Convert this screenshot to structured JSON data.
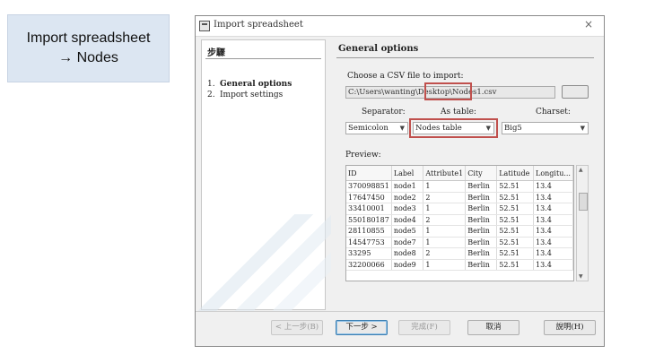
{
  "slide": {
    "caption_line1": "Import spreadsheet",
    "caption_line2": "→ Nodes"
  },
  "window": {
    "title": "Import spreadsheet",
    "close_glyph": "×"
  },
  "steps_panel": {
    "title": "步驟",
    "items": [
      {
        "num": "1.",
        "label": "General options"
      },
      {
        "num": "2.",
        "label": "Import settings"
      }
    ]
  },
  "general": {
    "section_title": "General options",
    "choose_label": "Choose a CSV file to import:",
    "file_path": "C:\\Users\\wanting\\Desktop\\Nodes1.csv",
    "separator_label": "Separator:",
    "separator_value": "Semicolon",
    "as_table_label": "As table:",
    "as_table_value": "Nodes table",
    "charset_label": "Charset:",
    "charset_value": "Big5"
  },
  "preview": {
    "label": "Preview:",
    "columns": [
      "ID",
      "Label",
      "Attribute1",
      "City",
      "Latitude",
      "Longitu..."
    ],
    "rows": [
      [
        "370098851",
        "node1",
        "1",
        "Berlin",
        "52.51",
        "13.4"
      ],
      [
        "17647450",
        "node2",
        "2",
        "Berlin",
        "52.51",
        "13.4"
      ],
      [
        "33410001",
        "node3",
        "1",
        "Berlin",
        "52.51",
        "13.4"
      ],
      [
        "550180187",
        "node4",
        "2",
        "Berlin",
        "52.51",
        "13.4"
      ],
      [
        "28110855",
        "node5",
        "1",
        "Berlin",
        "52.51",
        "13.4"
      ],
      [
        "14547753",
        "node7",
        "1",
        "Berlin",
        "52.51",
        "13.4"
      ],
      [
        "33295",
        "node8",
        "2",
        "Berlin",
        "52.51",
        "13.4"
      ],
      [
        "32200066",
        "node9",
        "1",
        "Berlin",
        "52.51",
        "13.4"
      ]
    ]
  },
  "buttons": {
    "back": "< 上一步(B)",
    "next": "下一步 >",
    "finish": "完成(F)",
    "cancel": "取消",
    "help": "說明(H)"
  },
  "colors": {
    "highlight": "#c0504d",
    "caption_bg": "#dce6f2"
  }
}
